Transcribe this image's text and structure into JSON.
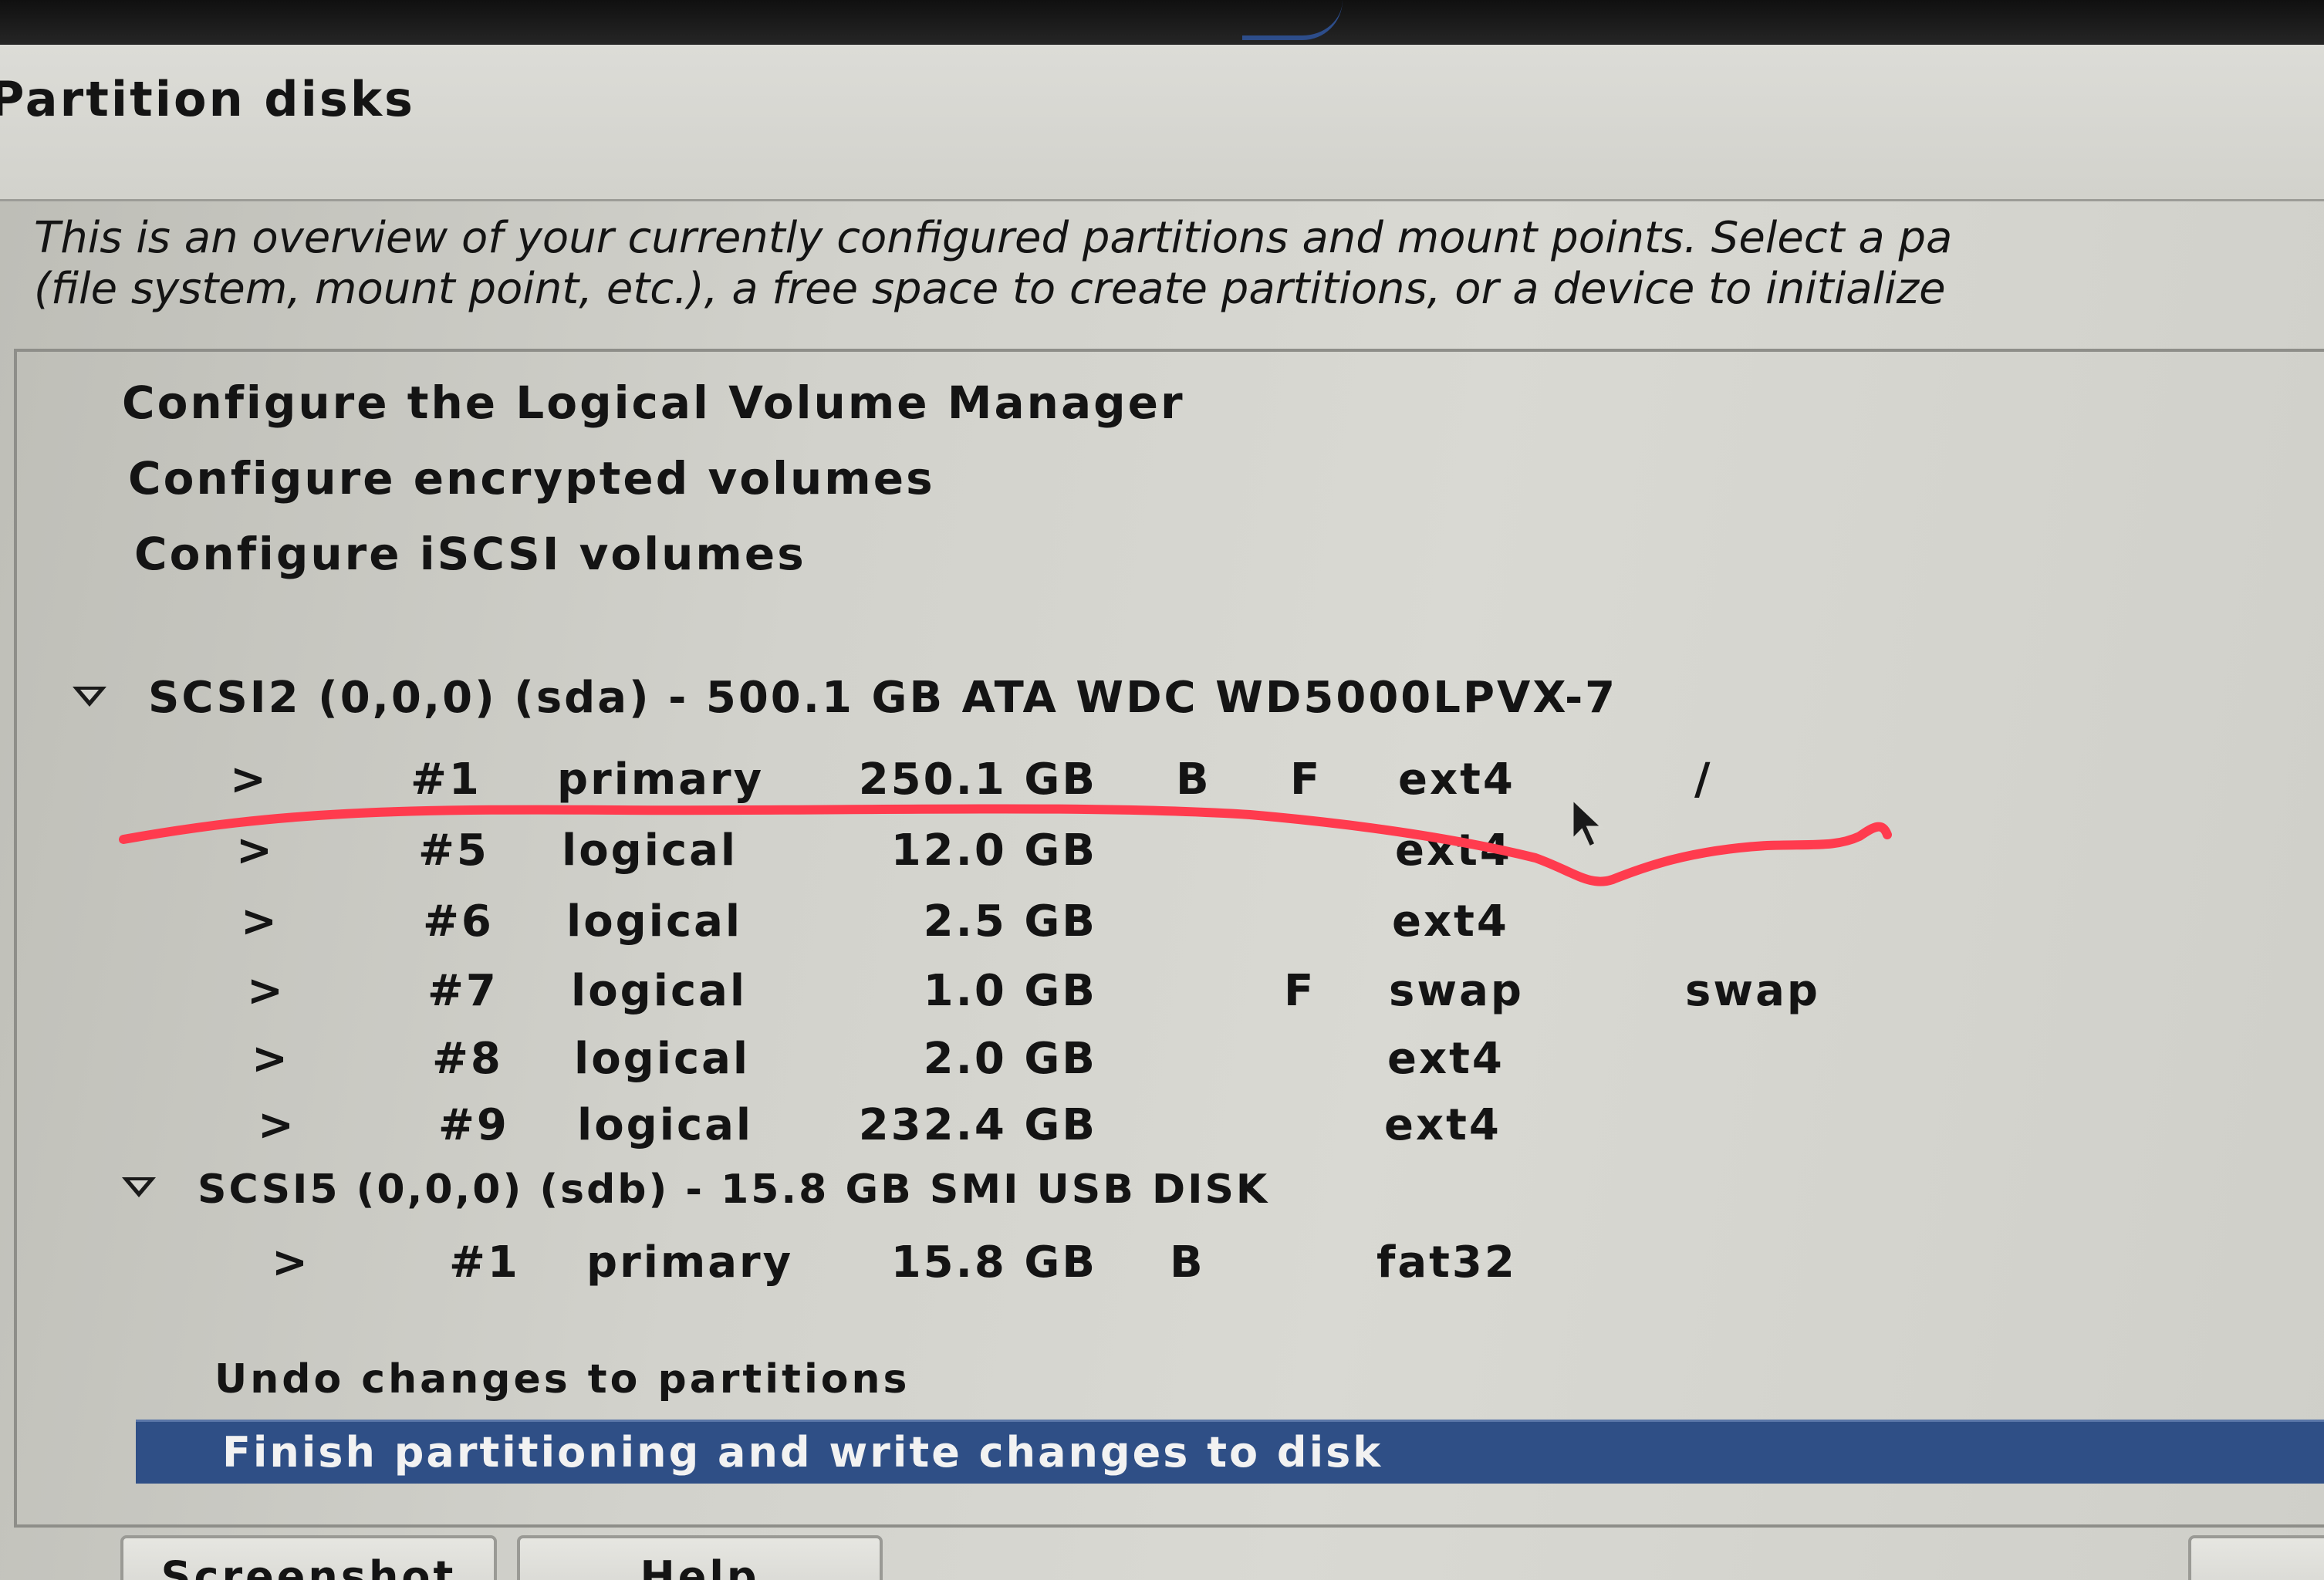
{
  "page": {
    "title": "Partition disks",
    "intro_line1": "This is an overview of your currently configured partitions and mount points. Select a pa",
    "intro_line2": "(file system, mount point, etc.), a free space to create partitions, or a device to initialize"
  },
  "menu": {
    "lvm": "Configure the Logical Volume Manager",
    "encrypted": "Configure encrypted volumes",
    "iscsi": "Configure iSCSI volumes"
  },
  "disks": [
    {
      "label": "SCSI2 (0,0,0) (sda) - 500.1 GB ATA WDC WD5000LPVX-7",
      "partitions": [
        {
          "arrow": ">",
          "num": "#1",
          "type": "primary",
          "size": "250.1 GB",
          "bootable": "B",
          "format": "F",
          "fs": "ext4",
          "mount": "/"
        },
        {
          "arrow": ">",
          "num": "#5",
          "type": "logical",
          "size": "12.0 GB",
          "bootable": "",
          "format": "",
          "fs": "ext4",
          "mount": ""
        },
        {
          "arrow": ">",
          "num": "#6",
          "type": "logical",
          "size": "2.5 GB",
          "bootable": "",
          "format": "",
          "fs": "ext4",
          "mount": ""
        },
        {
          "arrow": ">",
          "num": "#7",
          "type": "logical",
          "size": "1.0 GB",
          "bootable": "",
          "format": "F",
          "fs": "swap",
          "mount": "swap"
        },
        {
          "arrow": ">",
          "num": "#8",
          "type": "logical",
          "size": "2.0 GB",
          "bootable": "",
          "format": "",
          "fs": "ext4",
          "mount": ""
        },
        {
          "arrow": ">",
          "num": "#9",
          "type": "logical",
          "size": "232.4 GB",
          "bootable": "",
          "format": "",
          "fs": "ext4",
          "mount": ""
        }
      ]
    },
    {
      "label": "SCSI5 (0,0,0) (sdb) - 15.8 GB SMI USB DISK",
      "partitions": [
        {
          "arrow": ">",
          "num": "#1",
          "type": "primary",
          "size": "15.8 GB",
          "bootable": "B",
          "format": "",
          "fs": "fat32",
          "mount": ""
        }
      ]
    }
  ],
  "actions": {
    "undo": "Undo changes to partitions",
    "finish": "Finish partitioning and write changes to disk"
  },
  "buttons": {
    "screenshot": "Screenshot",
    "help": "Help"
  },
  "colors": {
    "selection": "#2f4f86",
    "annotation_stroke": "#ff3b4e"
  }
}
